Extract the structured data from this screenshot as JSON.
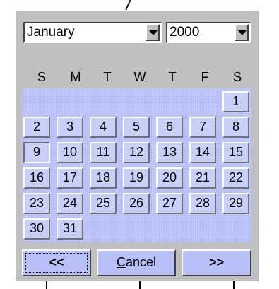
{
  "month_select": {
    "value": "January"
  },
  "year_select": {
    "value": "2000"
  },
  "weekdays": [
    "S",
    "M",
    "T",
    "W",
    "T",
    "F",
    "S"
  ],
  "calendar": {
    "first_weekday_index": 6,
    "days_in_month": 31,
    "current_day": 9,
    "days": [
      "1",
      "2",
      "3",
      "4",
      "5",
      "6",
      "7",
      "8",
      "9",
      "10",
      "11",
      "12",
      "13",
      "14",
      "15",
      "16",
      "17",
      "18",
      "19",
      "20",
      "21",
      "22",
      "23",
      "24",
      "25",
      "26",
      "27",
      "28",
      "29",
      "30",
      "31"
    ]
  },
  "buttons": {
    "prev": "<<",
    "cancel_mnemonic": "C",
    "cancel_rest": "ancel",
    "next": ">>"
  }
}
